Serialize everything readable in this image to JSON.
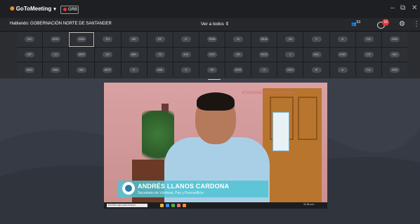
{
  "app": {
    "name": "GoToMeeting",
    "rec_label": "GRB"
  },
  "window_controls": {
    "minimize": "–",
    "restore": "⧉",
    "close": "✕"
  },
  "toolbar": {
    "speaking": "Hablando: GOBERNACIÓN NORTE DE SANTANDER",
    "view_all": "Ver a todos",
    "people_count": "53",
    "chat_badge": "18"
  },
  "participants": [
    [
      "AG",
      "DOC",
      "GNU",
      "PU",
      "AD",
      "RF",
      "G",
      "PAIN",
      "M",
      "MUA",
      "LB",
      "V",
      "A",
      "CA",
      "DIM"
    ],
    [
      "GP",
      "LH",
      "MDP",
      "DC",
      "ARL",
      "TH",
      "DSI",
      "HGT",
      "SR",
      "RCG",
      "C",
      "HDL",
      "CHR",
      "CR",
      "BH",
      "S"
    ],
    [
      "ANC",
      "SML",
      "MIL",
      "MCP",
      "D",
      "AMI",
      "G",
      "SE",
      "AFM",
      "O",
      "ODC",
      "IP",
      "A",
      "CA",
      "MIN",
      "C"
    ]
  ],
  "video": {
    "hashtag": "#FelizDíaDelServidorPúblico",
    "speaker_name": "ANDRÉS LLANOS CARDONA",
    "speaker_title": "Secretario de Víctimas, Paz y Posconflicto",
    "taskbar_search": "Escribe aquí para buscar",
    "taskbar_time": "11:36 a.m."
  },
  "colors": {
    "brand_orange": "#f68d2e",
    "record_red": "#e5343b",
    "lower_third": "#50c3d2"
  }
}
